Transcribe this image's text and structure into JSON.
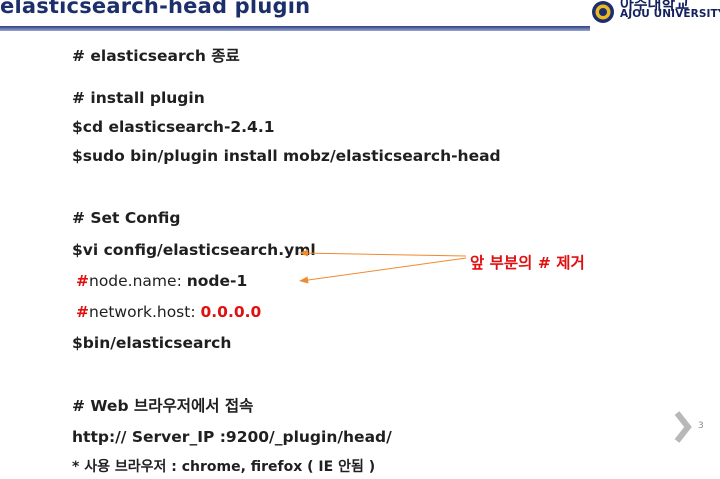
{
  "slide": {
    "title": "elasticsearch-head  plugin",
    "logo": {
      "korean": "아주대학교",
      "english": "AJOU UNIVERSITY"
    },
    "page_number": "3"
  },
  "content": {
    "l1": "# elasticsearch 종료",
    "l2": "# install plugin",
    "l3": "$cd   elasticsearch-2.4.1",
    "l4": "$sudo bin/plugin    install    mobz/elasticsearch-head",
    "l5": "# Set Config",
    "l6": "$vi config/elasticsearch.yml",
    "l7_hash": "#",
    "l7_key": "node.name: ",
    "l7_value": "node-1",
    "l8_hash": "#",
    "l8_key": "network.host: ",
    "l8_value": "0.0.0.0",
    "l9": "$bin/elasticsearch",
    "l10": "# Web 브라우저에서 접속",
    "l11": "http:// Server_IP :9200/_plugin/head/",
    "l12": "* 사용 브라우저 : chrome, firefox ( IE 안됨 )"
  },
  "annotation": {
    "text": "앞 부분의 # 제거",
    "color": "#e01010"
  },
  "colors": {
    "title": "#1c2f6b",
    "accent_red": "#e01010",
    "arrow": "#f08a30",
    "chevron": "#b8b8b8"
  }
}
